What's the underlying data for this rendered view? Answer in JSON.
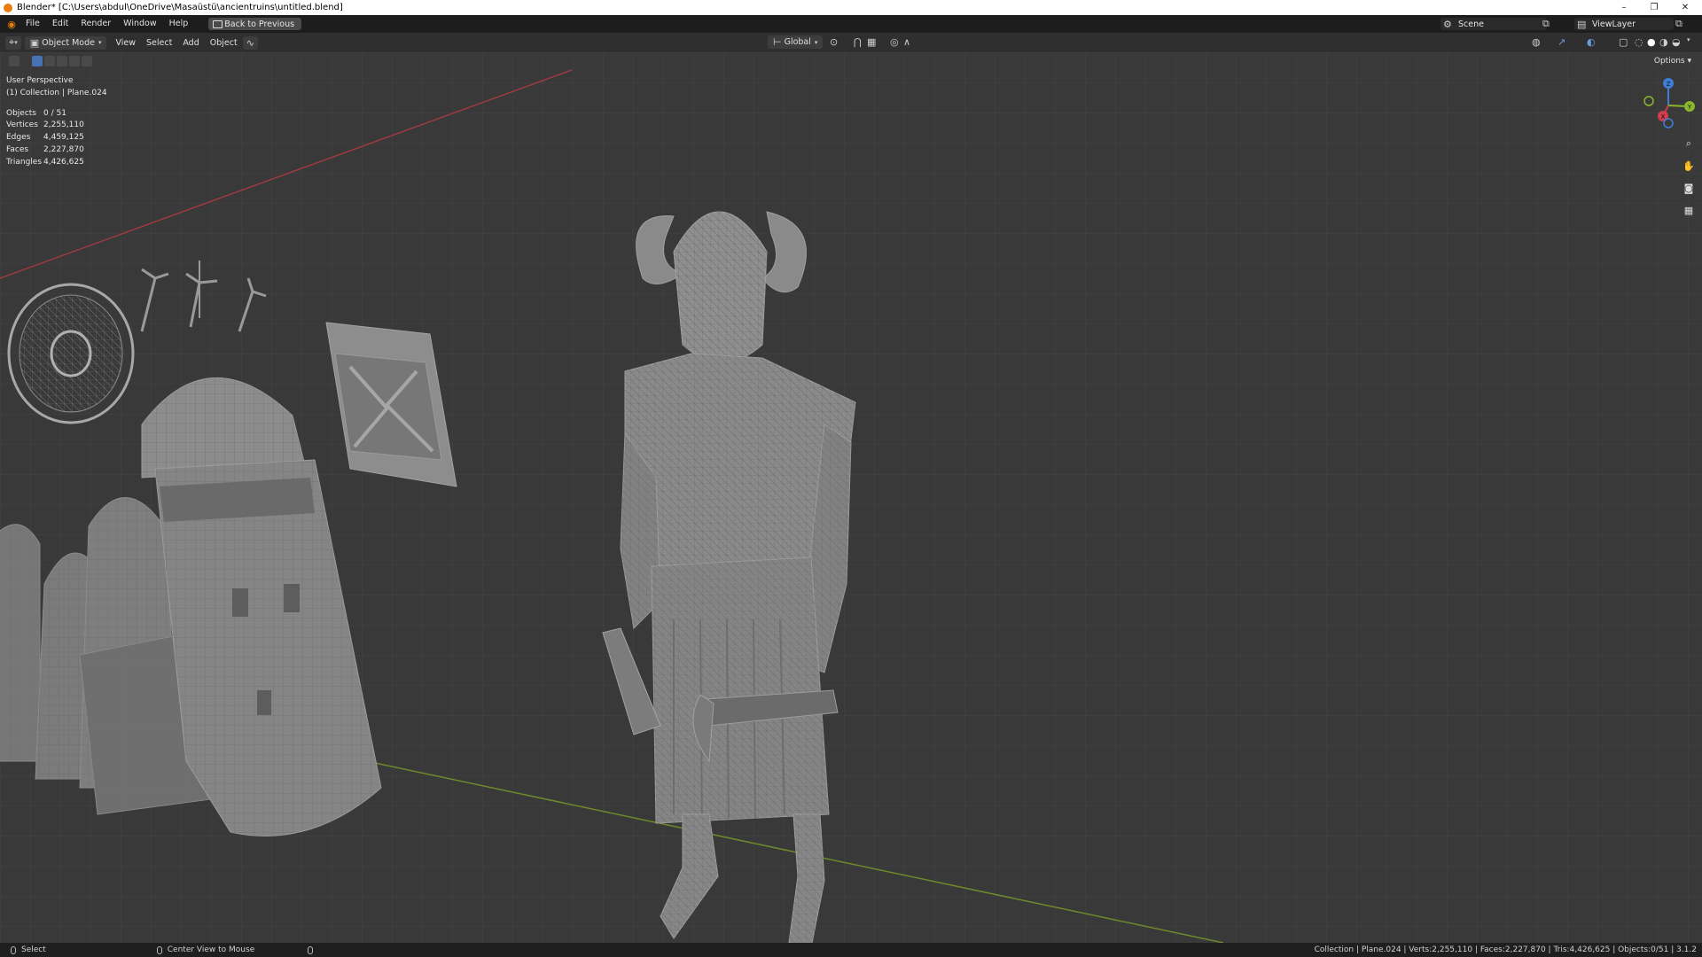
{
  "window": {
    "title": "Blender* [C:\\Users\\abdul\\OneDrive\\Masaüstü\\ancientruins\\untitled.blend]",
    "controls": [
      "–",
      "❐",
      "✕"
    ]
  },
  "topbar": {
    "menus": [
      "File",
      "Edit",
      "Render",
      "Window",
      "Help"
    ],
    "back_button": "Back to Previous",
    "scene": "Scene",
    "view_layer": "ViewLayer"
  },
  "header": {
    "mode": "Object Mode",
    "menus": [
      "View",
      "Select",
      "Add",
      "Object"
    ],
    "transform_orientation": "Global"
  },
  "viewport": {
    "view_name": "User Perspective",
    "collection": "(1) Collection | Plane.024",
    "stats": [
      {
        "label": "Objects",
        "value": "0 / 51"
      },
      {
        "label": "Vertices",
        "value": "2,255,110"
      },
      {
        "label": "Edges",
        "value": "4,459,125"
      },
      {
        "label": "Faces",
        "value": "2,227,870"
      },
      {
        "label": "Triangles",
        "value": "4,426,625"
      }
    ],
    "options_label": "Options",
    "gizmo_axes": {
      "x": "X",
      "y": "Y",
      "z": "Z"
    },
    "nav_icons": [
      "zoom-icon",
      "pan-hand-icon",
      "camera-icon",
      "grid-view-icon"
    ]
  },
  "statusbar": {
    "select": "Select",
    "center_view": "Center View to Mouse",
    "info": "Collection | Plane.024 | Verts:2,255,110 | Faces:2,227,870 | Tris:4,426,625 | Objects:0/51 | 3.1.2"
  },
  "colors": {
    "accent": "#4772b3",
    "x_axis": "#cf3e4b",
    "y_axis": "#8bb52f",
    "z_axis": "#3d7fd8",
    "brand": "#e87d0d"
  }
}
